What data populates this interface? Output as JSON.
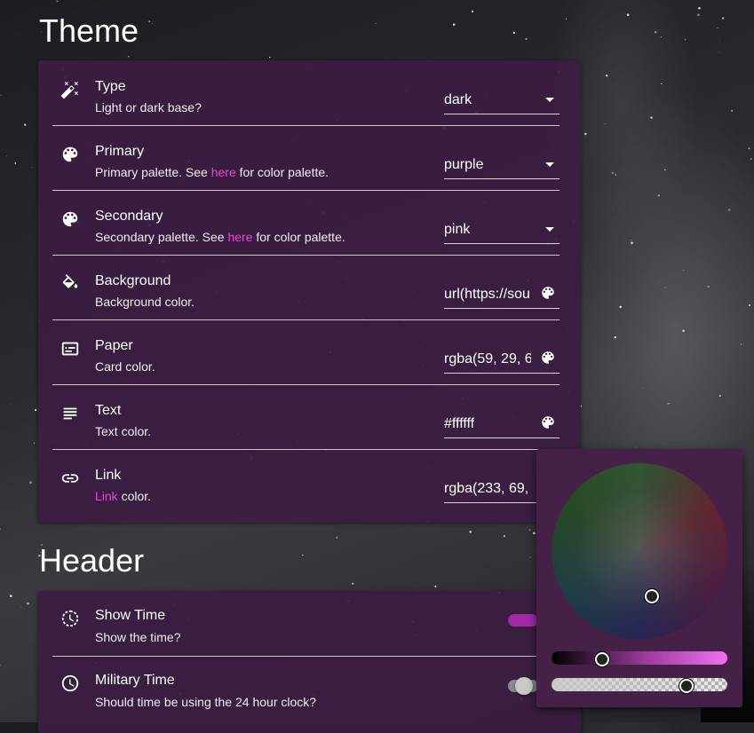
{
  "theme": {
    "title": "Theme",
    "rows": [
      {
        "label": "Type",
        "desc": "Light or dark base?",
        "value": "dark",
        "control": "select",
        "icon": "theme-toggle-icon"
      },
      {
        "label": "Primary",
        "desc_before": "Primary palette. See ",
        "desc_link": "here",
        "desc_after": " for color palette.",
        "value": "purple",
        "control": "select",
        "icon": "palette-icon"
      },
      {
        "label": "Secondary",
        "desc_before": "Secondary palette. See ",
        "desc_link": "here",
        "desc_after": " for color palette.",
        "value": "pink",
        "control": "select",
        "icon": "palette-icon"
      },
      {
        "label": "Background",
        "desc": "Background color.",
        "value": "url(https://sou",
        "control": "color",
        "icon": "paint-bucket-icon"
      },
      {
        "label": "Paper",
        "desc": "Card color.",
        "value": "rgba(59, 29, 6",
        "control": "color",
        "icon": "card-icon"
      },
      {
        "label": "Text",
        "desc": "Text color.",
        "value": "#ffffff",
        "control": "color",
        "icon": "text-lines-icon"
      },
      {
        "label": "Link",
        "desc_link": "Link",
        "desc_after": " color.",
        "value": "rgba(233, 69,",
        "control": "color",
        "icon": "link-icon"
      }
    ]
  },
  "header": {
    "title": "Header",
    "rows": [
      {
        "label": "Show Time",
        "desc": "Show the time?",
        "toggle_on": true,
        "icon": "clock-history-icon"
      },
      {
        "label": "Military Time",
        "desc": "Should time be using the 24 hour clock?",
        "toggle_on": false,
        "icon": "clock-icon"
      }
    ]
  },
  "color_picker": {
    "visible": true,
    "hue_fraction": 0.29,
    "alpha_fraction": 0.77
  },
  "colors": {
    "card": "#3b1d42",
    "link": "#e945d8",
    "toggle_on": "#c234c8",
    "toggle_off": "#bdbdbd"
  }
}
